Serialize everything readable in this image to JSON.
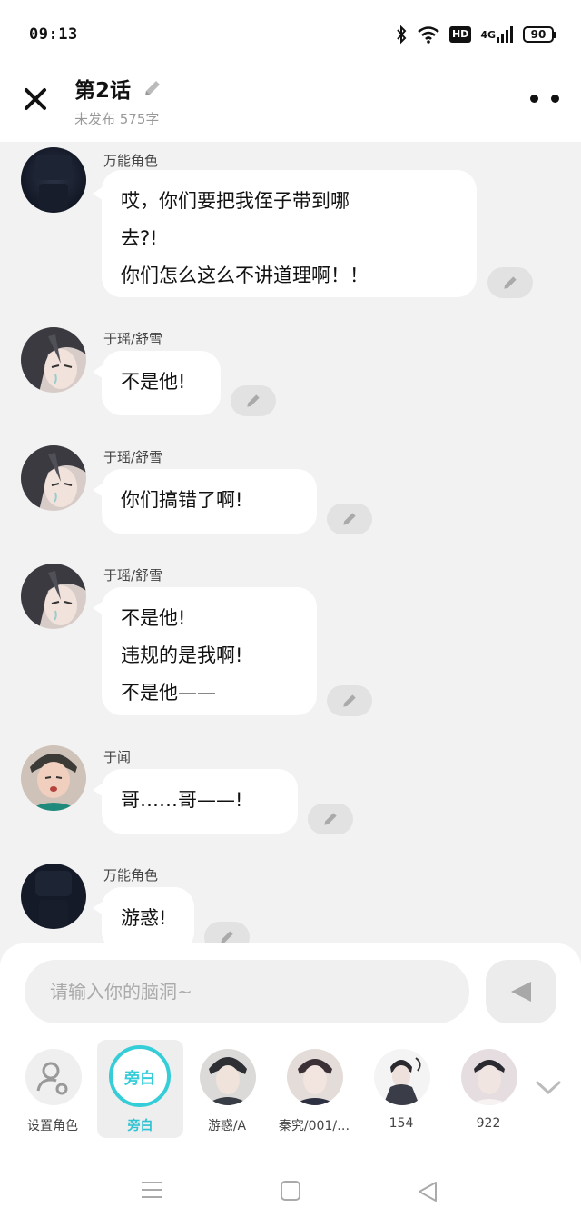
{
  "status_bar": {
    "time": "09:13",
    "hd": "HD",
    "network": "4G",
    "battery": "90"
  },
  "header": {
    "title": "第2话",
    "subtitle": "未发布 575字"
  },
  "messages": [
    {
      "name": "万能角色",
      "lines": [
        "哎，你们要把我侄子带到哪",
        "去?!",
        "你们怎么这么不讲道理啊！！"
      ],
      "avatar": "dark-figure"
    },
    {
      "name": "于瑶/舒雪",
      "lines": [
        "不是他!"
      ],
      "avatar": "crying-girl"
    },
    {
      "name": "于瑶/舒雪",
      "lines": [
        "你们搞错了啊!"
      ],
      "avatar": "crying-girl"
    },
    {
      "name": "于瑶/舒雪",
      "lines": [
        "不是他!",
        "违规的是我啊!",
        "不是他——"
      ],
      "avatar": "crying-girl"
    },
    {
      "name": "于闻",
      "lines": [
        "哥……哥——!"
      ],
      "avatar": "boy-green"
    },
    {
      "name": "万能角色",
      "lines": [
        "游惑!"
      ],
      "avatar": "dark-figure"
    }
  ],
  "input": {
    "placeholder": "请输入你的脑洞~"
  },
  "roles": [
    {
      "label": "设置角色",
      "type": "settings"
    },
    {
      "label": "旁白",
      "badge": "旁白",
      "type": "narrator",
      "selected": true
    },
    {
      "label": "游惑/A",
      "type": "avatar"
    },
    {
      "label": "秦究/001/…",
      "type": "avatar"
    },
    {
      "label": "154",
      "type": "avatar"
    },
    {
      "label": "922",
      "type": "avatar"
    }
  ],
  "colors": {
    "accent": "#35cdd8",
    "background": "#f2f2f2",
    "bubble": "#ffffff"
  }
}
